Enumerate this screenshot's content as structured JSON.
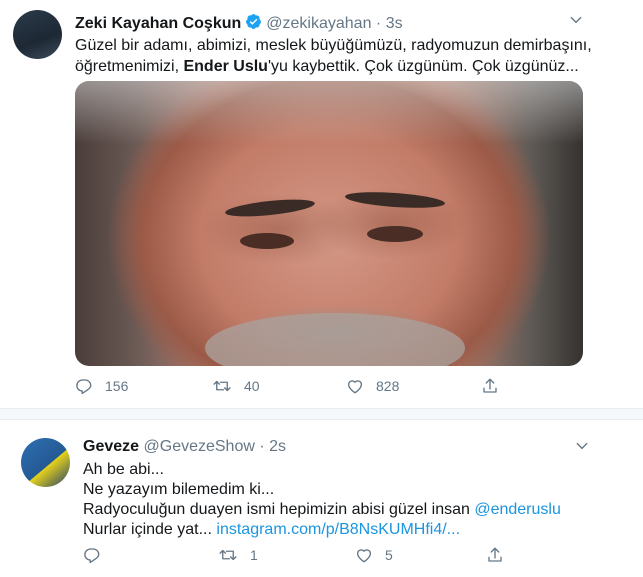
{
  "tweet1": {
    "name": "Zeki Kayahan Coşkun",
    "handle": "@zekikayahan",
    "separator": "·",
    "time": "3s",
    "text_line1": "Güzel bir adamı, abimizi,  meslek büyüğümüzü, radyomuzun demirbaşını,",
    "text_line2_before": "öğretmenimizi, ",
    "text_line2_mention": "Ender Uslu",
    "text_line2_after": "'yu kaybettik. Çok üzgünüm. Çok üzgünüz...",
    "reply_count": "156",
    "retweet_count": "40",
    "like_count": "828"
  },
  "tweet2": {
    "name": "Geveze",
    "handle": "@GevezeShow",
    "separator": "·",
    "time": "2s",
    "line1": "Ah be abi...",
    "line2": "Ne yazayım bilemedim ki...",
    "line3_before": "Radyoculuğun duayen ismi hepimizin abisi güzel insan ",
    "line3_mention": "@enderuslu",
    "line4_before": "Nurlar içinde yat... ",
    "line4_link": "instagram.com/p/B8NsKUMHfi4/...",
    "reply_count": "",
    "retweet_count": "1",
    "like_count": "5"
  },
  "colors": {
    "text": "#14171a",
    "secondary": "#657786",
    "link": "#1b95e0",
    "verified": "#1da1f2"
  },
  "icons": [
    "verified-icon",
    "chevron-down-icon",
    "reply-icon",
    "retweet-icon",
    "like-icon",
    "share-icon"
  ]
}
